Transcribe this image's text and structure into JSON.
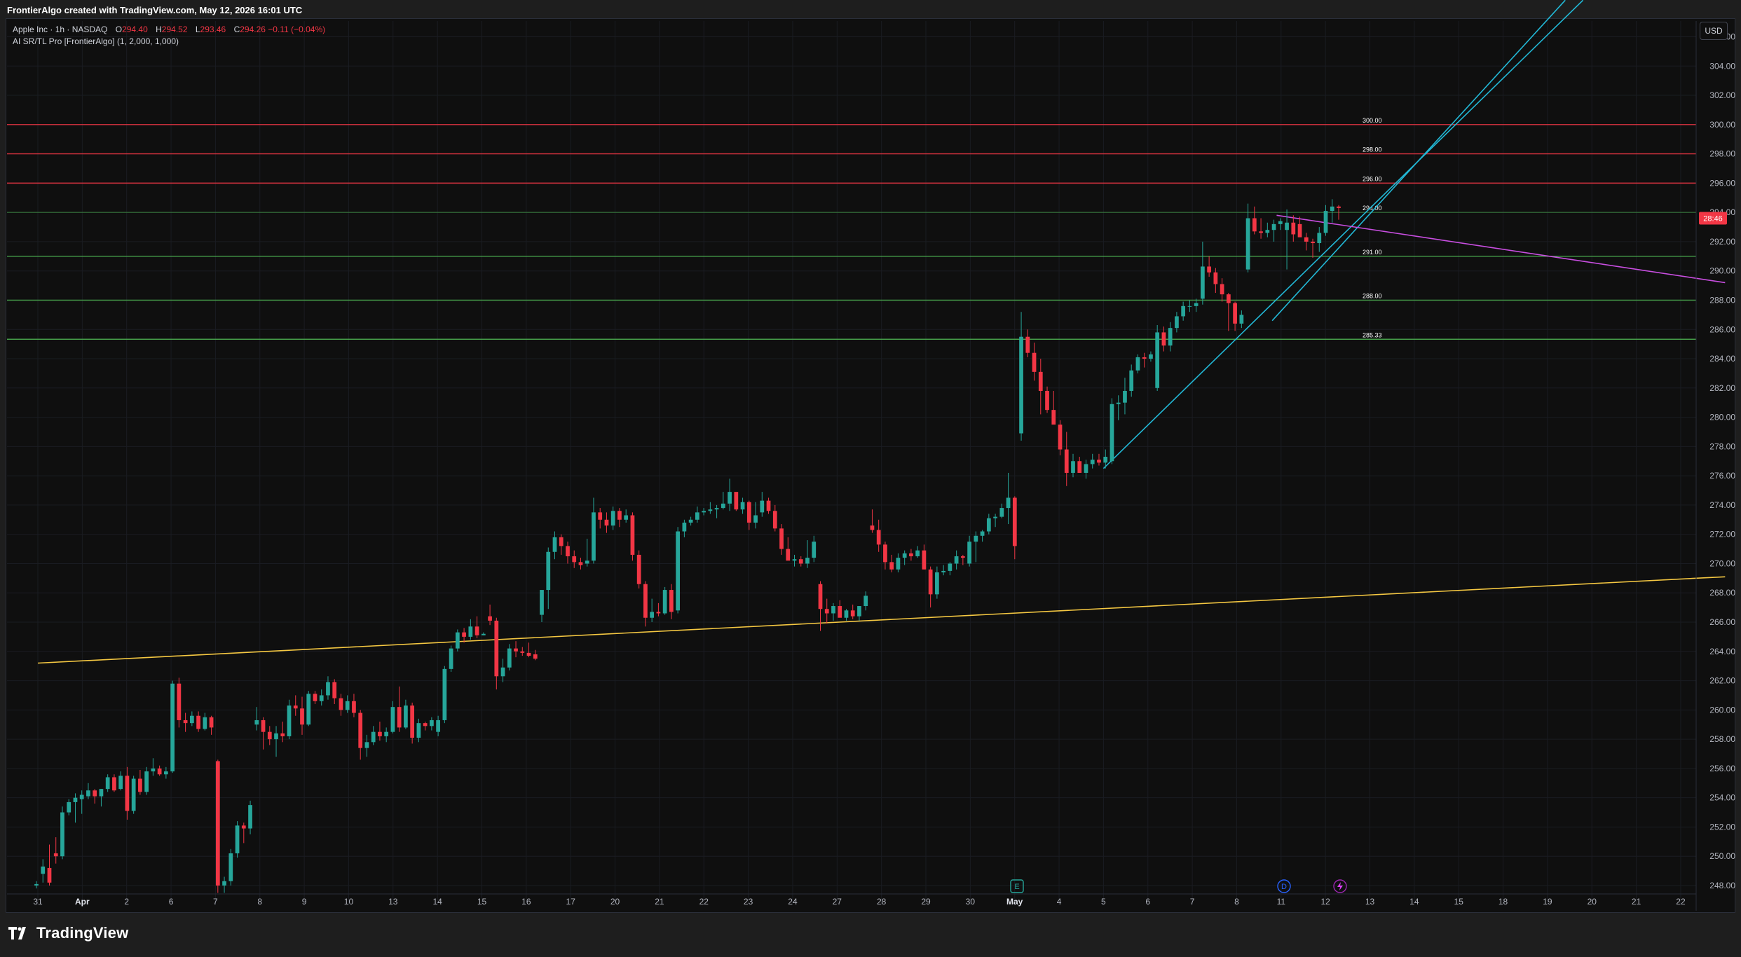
{
  "header": {
    "caption": "FrontierAlgo created with TradingView.com, May 12, 2026 16:01 UTC"
  },
  "legend": {
    "symbol": "Apple Inc · 1h · NASDAQ",
    "o_label": "O",
    "o_value": "294.40",
    "h_label": "H",
    "h_value": "294.52",
    "l_label": "L",
    "l_value": "293.46",
    "c_label": "C",
    "c_value": "294.26",
    "change": "−0.11 (−0.04%)",
    "indicator": "AI SR/TL Pro [FrontierAlgo] (1, 2,000, 1,000)"
  },
  "currency_button": "USD",
  "branding": {
    "name": "TradingView",
    "icon": "tradingview-logo-icon"
  },
  "colors": {
    "up": "#26a69a",
    "down": "#f23645",
    "resistance": "#f23645",
    "support": "#4caf50",
    "trend_yellow": "#f5c842",
    "trend_cyan": "#22b8d6",
    "trend_magenta": "#c84ee0",
    "background": "#0f0f0f"
  },
  "chart_data": {
    "type": "candlestick",
    "symbol": "AAPL",
    "timeframe": "1h",
    "ylim": [
      247.0,
      307.6
    ],
    "y_ticks": [
      "248.00",
      "250.00",
      "252.00",
      "254.00",
      "256.00",
      "258.00",
      "260.00",
      "262.00",
      "264.00",
      "266.00",
      "268.00",
      "270.00",
      "272.00",
      "274.00",
      "276.00",
      "278.00",
      "280.00",
      "282.00",
      "284.00",
      "286.00",
      "288.00",
      "290.00",
      "292.00",
      "294.00",
      "296.00",
      "298.00",
      "300.00",
      "302.00",
      "304.00",
      "306.00"
    ],
    "x_ticks": [
      "31",
      "Apr",
      "2",
      "6",
      "7",
      "8",
      "9",
      "10",
      "13",
      "14",
      "15",
      "16",
      "17",
      "20",
      "21",
      "22",
      "23",
      "24",
      "27",
      "28",
      "29",
      "30",
      "May",
      "4",
      "5",
      "6",
      "7",
      "8",
      "11",
      "12",
      "13",
      "14",
      "15",
      "18",
      "19",
      "20",
      "21",
      "22"
    ],
    "last_price_label": "28:46",
    "levels": [
      {
        "kind": "resistance",
        "price": 300.0,
        "label": "300.00"
      },
      {
        "kind": "resistance",
        "price": 298.0,
        "label": "298.00"
      },
      {
        "kind": "resistance",
        "price": 296.0,
        "label": "296.00"
      },
      {
        "kind": "support",
        "price": 294.0,
        "label": "294.00"
      },
      {
        "kind": "support",
        "price": 291.0,
        "label": "291.00"
      },
      {
        "kind": "support",
        "price": 288.0,
        "label": "288.00"
      },
      {
        "kind": "support",
        "price": 285.33,
        "label": "285.33"
      }
    ],
    "trendlines": [
      {
        "name": "long-support",
        "color": "yellow",
        "from": [
          0,
          263.2
        ],
        "to": [
          38,
          269.1
        ]
      },
      {
        "name": "rising-support-1",
        "color": "cyan",
        "from": [
          24.0,
          276.5
        ],
        "to": [
          34.8,
          308.5
        ]
      },
      {
        "name": "rising-support-2",
        "color": "cyan",
        "from": [
          27.8,
          286.6
        ],
        "to": [
          34.4,
          308.5
        ]
      },
      {
        "name": "falling-resistance",
        "color": "magenta",
        "from": [
          27.9,
          293.8
        ],
        "to": [
          38,
          289.2
        ]
      }
    ],
    "candles": [
      [
        248.0,
        248.3,
        247.8,
        248.1
      ],
      [
        248.8,
        249.8,
        248.2,
        249.3
      ],
      [
        249.2,
        250.8,
        248.0,
        248.2
      ],
      [
        250.2,
        251.3,
        249.5,
        250.0
      ],
      [
        250.0,
        253.4,
        249.8,
        253.0
      ],
      [
        253.0,
        253.9,
        252.8,
        253.7
      ],
      [
        253.7,
        254.3,
        252.3,
        254.0
      ],
      [
        253.9,
        254.5,
        252.9,
        254.2
      ],
      [
        254.1,
        255.0,
        253.9,
        254.5
      ],
      [
        254.5,
        254.6,
        253.6,
        254.1
      ],
      [
        254.1,
        254.6,
        253.4,
        254.6
      ],
      [
        254.6,
        255.6,
        254.4,
        255.4
      ],
      [
        255.4,
        255.6,
        254.4,
        254.5
      ],
      [
        254.6,
        255.8,
        254.5,
        255.5
      ],
      [
        255.5,
        256.1,
        252.5,
        253.1
      ],
      [
        253.1,
        255.5,
        252.9,
        255.3
      ],
      [
        255.3,
        255.9,
        254.2,
        254.4
      ],
      [
        254.4,
        256.1,
        254.2,
        255.8
      ],
      [
        255.8,
        256.7,
        255.5,
        256.0
      ],
      [
        256.0,
        256.2,
        255.5,
        255.6
      ],
      [
        255.6,
        256.1,
        255.3,
        255.8
      ],
      [
        255.8,
        262.0,
        255.7,
        261.8
      ],
      [
        261.8,
        262.2,
        258.8,
        259.3
      ],
      [
        259.3,
        259.8,
        258.5,
        259.1
      ],
      [
        259.1,
        259.9,
        258.9,
        259.6
      ],
      [
        259.6,
        259.9,
        258.5,
        258.7
      ],
      [
        258.7,
        259.8,
        258.6,
        259.5
      ],
      [
        259.5,
        259.6,
        258.3,
        258.8
      ],
      [
        256.5,
        256.6,
        247.5,
        248.0
      ],
      [
        248.0,
        248.6,
        247.5,
        248.3
      ],
      [
        248.3,
        250.5,
        248.0,
        250.2
      ],
      [
        250.2,
        252.4,
        249.9,
        252.1
      ],
      [
        252.1,
        252.3,
        250.9,
        251.9
      ],
      [
        251.9,
        253.8,
        251.5,
        253.5
      ],
      [
        259.0,
        260.2,
        258.6,
        259.3
      ],
      [
        259.3,
        259.5,
        257.3,
        258.5
      ],
      [
        258.5,
        258.9,
        257.6,
        258.0
      ],
      [
        258.0,
        258.9,
        256.8,
        258.4
      ],
      [
        258.4,
        259.2,
        257.8,
        258.2
      ],
      [
        258.2,
        260.7,
        258.0,
        260.3
      ],
      [
        260.3,
        261.0,
        259.6,
        260.1
      ],
      [
        260.1,
        260.9,
        258.3,
        259.0
      ],
      [
        259.0,
        261.3,
        258.9,
        261.1
      ],
      [
        261.1,
        261.3,
        260.4,
        260.6
      ],
      [
        260.6,
        261.4,
        260.3,
        261.0
      ],
      [
        261.0,
        262.3,
        260.7,
        261.9
      ],
      [
        261.9,
        262.1,
        260.4,
        260.8
      ],
      [
        260.8,
        261.1,
        259.6,
        260.0
      ],
      [
        260.0,
        261.0,
        259.8,
        260.6
      ],
      [
        260.6,
        261.1,
        259.5,
        259.8
      ],
      [
        259.8,
        260.0,
        256.6,
        257.4
      ],
      [
        257.4,
        258.3,
        256.8,
        257.8
      ],
      [
        257.8,
        258.9,
        257.6,
        258.5
      ],
      [
        258.5,
        259.2,
        257.9,
        258.2
      ],
      [
        258.2,
        258.8,
        257.8,
        258.5
      ],
      [
        258.5,
        260.6,
        258.4,
        260.2
      ],
      [
        260.2,
        261.6,
        258.5,
        258.8
      ],
      [
        258.8,
        260.7,
        258.7,
        260.3
      ],
      [
        260.3,
        260.5,
        257.7,
        258.1
      ],
      [
        258.1,
        259.4,
        257.8,
        259.1
      ],
      [
        259.1,
        259.2,
        258.6,
        258.9
      ],
      [
        258.9,
        259.5,
        258.6,
        259.3
      ],
      [
        258.5,
        259.6,
        258.2,
        259.3
      ],
      [
        259.3,
        263.0,
        259.1,
        262.8
      ],
      [
        262.8,
        264.4,
        262.6,
        264.2
      ],
      [
        264.2,
        265.5,
        264.0,
        265.3
      ],
      [
        265.3,
        265.6,
        264.6,
        265.0
      ],
      [
        265.0,
        266.2,
        264.8,
        265.7
      ],
      [
        265.7,
        266.4,
        264.9,
        265.1
      ],
      [
        265.1,
        265.3,
        265.1,
        265.2
      ],
      [
        266.4,
        267.2,
        265.8,
        266.1
      ],
      [
        266.1,
        266.3,
        261.4,
        262.3
      ],
      [
        262.3,
        263.5,
        261.9,
        262.9
      ],
      [
        262.9,
        264.5,
        262.7,
        264.2
      ],
      [
        264.2,
        264.7,
        263.6,
        264.0
      ],
      [
        264.0,
        264.3,
        263.7,
        263.9
      ],
      [
        263.9,
        264.6,
        263.6,
        263.7
      ],
      [
        263.8,
        264.1,
        263.4,
        263.5
      ],
      [
        266.5,
        267.3,
        266.0,
        268.2
      ],
      [
        268.2,
        271.1,
        266.9,
        270.8
      ],
      [
        270.8,
        272.2,
        270.3,
        271.8
      ],
      [
        271.8,
        272.0,
        270.6,
        271.2
      ],
      [
        271.2,
        271.5,
        270.0,
        270.5
      ],
      [
        270.5,
        270.9,
        269.7,
        270.1
      ],
      [
        270.1,
        270.4,
        269.6,
        269.9
      ],
      [
        270.0,
        271.7,
        269.8,
        270.2
      ],
      [
        270.2,
        274.5,
        270.0,
        273.5
      ],
      [
        273.5,
        273.8,
        272.4,
        273.0
      ],
      [
        273.0,
        273.5,
        272.1,
        272.6
      ],
      [
        272.6,
        273.9,
        272.3,
        273.6
      ],
      [
        273.6,
        273.8,
        272.5,
        273.0
      ],
      [
        273.0,
        273.7,
        272.8,
        273.3
      ],
      [
        273.3,
        273.5,
        270.2,
        270.6
      ],
      [
        270.6,
        270.9,
        268.3,
        268.6
      ],
      [
        268.6,
        268.8,
        265.7,
        266.3
      ],
      [
        266.3,
        267.6,
        266.0,
        266.7
      ],
      [
        266.7,
        267.3,
        266.4,
        266.6
      ],
      [
        266.6,
        268.4,
        266.5,
        268.2
      ],
      [
        268.2,
        268.6,
        266.2,
        266.7
      ],
      [
        266.8,
        272.5,
        266.6,
        272.2
      ],
      [
        272.2,
        273.0,
        271.8,
        272.8
      ],
      [
        272.8,
        273.2,
        272.6,
        273.0
      ],
      [
        273.0,
        273.9,
        272.8,
        273.5
      ],
      [
        273.5,
        273.8,
        273.3,
        273.6
      ],
      [
        273.6,
        274.2,
        273.4,
        273.7
      ],
      [
        273.7,
        274.0,
        273.1,
        273.8
      ],
      [
        273.8,
        274.9,
        273.7,
        274.1
      ],
      [
        274.1,
        275.8,
        273.6,
        274.9
      ],
      [
        274.9,
        274.8,
        273.6,
        273.7
      ],
      [
        273.7,
        274.5,
        273.4,
        274.2
      ],
      [
        274.2,
        274.3,
        272.3,
        272.8
      ],
      [
        272.8,
        274.2,
        272.4,
        273.3
      ],
      [
        273.5,
        274.9,
        273.2,
        274.3
      ],
      [
        274.3,
        274.5,
        273.4,
        273.6
      ],
      [
        273.6,
        274.0,
        272.2,
        272.4
      ],
      [
        272.4,
        272.7,
        270.6,
        271.0
      ],
      [
        271.0,
        271.8,
        270.4,
        270.2
      ],
      [
        270.2,
        270.6,
        269.8,
        270.3
      ],
      [
        270.3,
        270.5,
        269.8,
        270.0
      ],
      [
        270.0,
        271.6,
        269.7,
        270.4
      ],
      [
        270.4,
        271.9,
        270.1,
        271.5
      ],
      [
        268.6,
        268.8,
        265.4,
        266.9
      ],
      [
        266.9,
        267.6,
        265.9,
        266.6
      ],
      [
        266.6,
        267.3,
        266.1,
        267.1
      ],
      [
        267.1,
        267.5,
        266.8,
        266.3
      ],
      [
        266.3,
        266.9,
        266.1,
        266.8
      ],
      [
        266.8,
        267.2,
        266.2,
        266.4
      ],
      [
        266.4,
        267.1,
        266.1,
        267.1
      ],
      [
        267.1,
        268.1,
        266.8,
        267.8
      ],
      [
        272.6,
        273.7,
        272.1,
        272.3
      ],
      [
        272.3,
        273.0,
        270.8,
        271.3
      ],
      [
        271.3,
        271.5,
        269.6,
        270.1
      ],
      [
        270.1,
        270.6,
        269.4,
        269.6
      ],
      [
        269.6,
        270.7,
        269.4,
        270.4
      ],
      [
        270.4,
        270.9,
        269.9,
        270.7
      ],
      [
        270.7,
        271.0,
        270.2,
        270.5
      ],
      [
        270.5,
        271.2,
        270.4,
        270.9
      ],
      [
        270.9,
        271.3,
        269.6,
        269.6
      ],
      [
        269.6,
        269.8,
        267.0,
        267.9
      ],
      [
        267.9,
        269.8,
        267.6,
        269.4
      ],
      [
        269.4,
        269.9,
        269.2,
        269.5
      ],
      [
        269.5,
        270.1,
        269.2,
        270.0
      ],
      [
        270.0,
        270.9,
        269.6,
        270.5
      ],
      [
        270.5,
        270.6,
        269.9,
        270.4
      ],
      [
        270.0,
        271.9,
        269.8,
        271.5
      ],
      [
        271.5,
        272.2,
        270.1,
        271.9
      ],
      [
        271.9,
        272.3,
        271.5,
        272.2
      ],
      [
        272.2,
        273.4,
        272.0,
        273.1
      ],
      [
        273.1,
        273.4,
        272.5,
        273.2
      ],
      [
        273.2,
        274.1,
        273.1,
        273.8
      ],
      [
        273.8,
        276.2,
        272.7,
        274.5
      ],
      [
        274.5,
        274.6,
        270.3,
        271.2
      ],
      [
        278.9,
        287.2,
        278.4,
        285.5
      ],
      [
        285.5,
        286.0,
        284.1,
        284.4
      ],
      [
        284.4,
        285.1,
        282.5,
        283.1
      ],
      [
        283.1,
        284.0,
        280.2,
        281.8
      ],
      [
        281.8,
        282.1,
        280.3,
        280.5
      ],
      [
        280.5,
        281.8,
        279.8,
        279.5
      ],
      [
        279.5,
        279.8,
        277.4,
        277.8
      ],
      [
        277.8,
        279.0,
        275.3,
        276.2
      ],
      [
        276.2,
        277.5,
        275.9,
        277.0
      ],
      [
        277.0,
        277.3,
        276.2,
        276.2
      ],
      [
        276.2,
        277.1,
        275.8,
        276.8
      ],
      [
        276.8,
        277.5,
        276.5,
        277.1
      ],
      [
        277.1,
        277.5,
        276.7,
        276.9
      ],
      [
        276.9,
        277.8,
        276.5,
        277.3
      ],
      [
        277.0,
        281.3,
        276.8,
        280.9
      ],
      [
        280.9,
        281.5,
        279.8,
        281.0
      ],
      [
        281.0,
        282.7,
        280.2,
        281.8
      ],
      [
        281.8,
        283.6,
        281.4,
        283.2
      ],
      [
        283.2,
        284.3,
        283.0,
        284.1
      ],
      [
        284.1,
        284.4,
        283.4,
        284.0
      ],
      [
        284.0,
        284.5,
        283.8,
        284.3
      ],
      [
        282.0,
        286.3,
        281.8,
        285.8
      ],
      [
        285.8,
        286.2,
        284.5,
        284.9
      ],
      [
        284.9,
        286.5,
        284.5,
        286.1
      ],
      [
        286.1,
        287.2,
        285.8,
        286.9
      ],
      [
        286.9,
        287.9,
        286.6,
        287.6
      ],
      [
        287.6,
        288.0,
        287.2,
        287.6
      ],
      [
        287.6,
        288.1,
        287.2,
        287.8
      ],
      [
        288.1,
        292.0,
        287.7,
        290.3
      ],
      [
        290.3,
        291.0,
        289.6,
        289.9
      ],
      [
        289.9,
        290.2,
        288.5,
        289.1
      ],
      [
        289.1,
        289.5,
        287.9,
        288.4
      ],
      [
        288.4,
        288.5,
        285.9,
        287.8
      ],
      [
        287.8,
        287.9,
        285.9,
        286.4
      ],
      [
        286.4,
        287.3,
        286.1,
        287.0
      ],
      [
        290.1,
        294.6,
        289.9,
        293.6
      ],
      [
        293.6,
        294.4,
        292.5,
        292.7
      ],
      [
        292.7,
        293.6,
        292.2,
        292.6
      ],
      [
        292.6,
        293.3,
        292.3,
        292.8
      ],
      [
        292.8,
        293.5,
        292.0,
        293.2
      ],
      [
        293.2,
        293.6,
        292.8,
        293.4
      ],
      [
        292.8,
        294.2,
        290.1,
        293.3
      ],
      [
        293.3,
        293.8,
        292.0,
        292.5
      ],
      [
        293.2,
        293.7,
        292.5,
        292.3
      ],
      [
        292.3,
        292.6,
        291.4,
        292.0
      ],
      [
        292.0,
        292.2,
        290.9,
        291.9
      ],
      [
        291.9,
        293.0,
        291.3,
        292.6
      ],
      [
        292.6,
        294.5,
        292.4,
        294.1
      ],
      [
        294.1,
        294.9,
        293.3,
        294.4
      ],
      [
        294.4,
        294.5,
        293.5,
        294.3
      ]
    ]
  }
}
